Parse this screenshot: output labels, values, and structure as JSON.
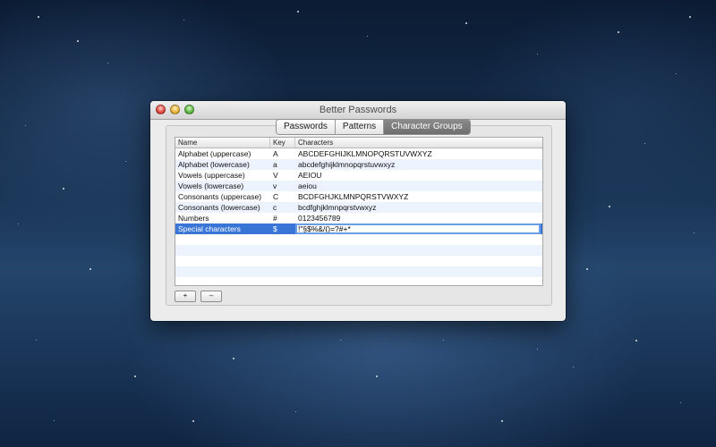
{
  "window": {
    "title": "Better Passwords"
  },
  "tabs": [
    {
      "label": "Passwords",
      "active": false
    },
    {
      "label": "Patterns",
      "active": false
    },
    {
      "label": "Character Groups",
      "active": true
    }
  ],
  "table": {
    "headers": {
      "name": "Name",
      "key": "Key",
      "characters": "Characters"
    },
    "rows": [
      {
        "name": "Alphabet (uppercase)",
        "key": "A",
        "characters": "ABCDEFGHIJKLMNOPQRSTUVWXYZ"
      },
      {
        "name": "Alphabet (lowercase)",
        "key": "a",
        "characters": "abcdefghijklmnopqrstuvwxyz"
      },
      {
        "name": "Vowels (uppercase)",
        "key": "V",
        "characters": "AEIOU"
      },
      {
        "name": "Vowels (lowercase)",
        "key": "v",
        "characters": "aeiou"
      },
      {
        "name": "Consonants (uppercase)",
        "key": "C",
        "characters": "BCDFGHJKLMNPQRSTVWXYZ"
      },
      {
        "name": "Consonants (lowercase)",
        "key": "c",
        "characters": "bcdfghjklmnpqrstvwxyz"
      },
      {
        "name": "Numbers",
        "key": "#",
        "characters": "0123456789"
      },
      {
        "name": "Special characters",
        "key": "$",
        "characters": "!\"§$%&/()=?#+*"
      }
    ]
  },
  "buttons": {
    "add": "+",
    "remove": "–"
  }
}
